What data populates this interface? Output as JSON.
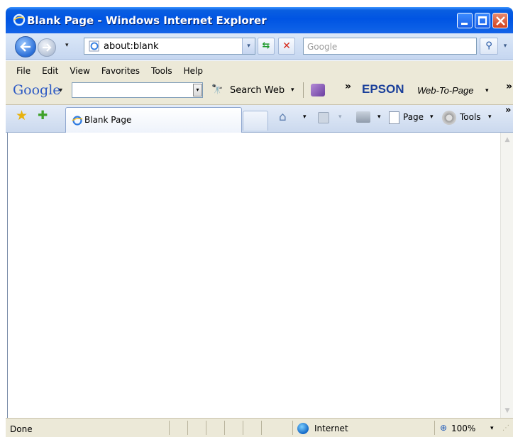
{
  "window": {
    "title": "Blank Page - Windows Internet Explorer"
  },
  "navigation": {
    "address_value": "about:blank",
    "search_placeholder": "Google"
  },
  "menubar": {
    "items": [
      "File",
      "Edit",
      "View",
      "Favorites",
      "Tools",
      "Help"
    ]
  },
  "google_toolbar": {
    "logo": "Google",
    "search_web_label": "Search Web",
    "epson_label": "EPSON",
    "web_to_page_label": "Web-To-Page"
  },
  "tabs": {
    "active_label": "Blank Page"
  },
  "command_bar": {
    "page_label": "Page",
    "tools_label": "Tools"
  },
  "statusbar": {
    "status": "Done",
    "zone": "Internet",
    "zoom": "100%"
  },
  "icons": {
    "arrow": "▾",
    "chevron_more": "»"
  },
  "colors": {
    "titlebar_blue": "#0054e3",
    "chrome_gray": "#ece9d8",
    "epson_blue": "#1a3f9a"
  }
}
